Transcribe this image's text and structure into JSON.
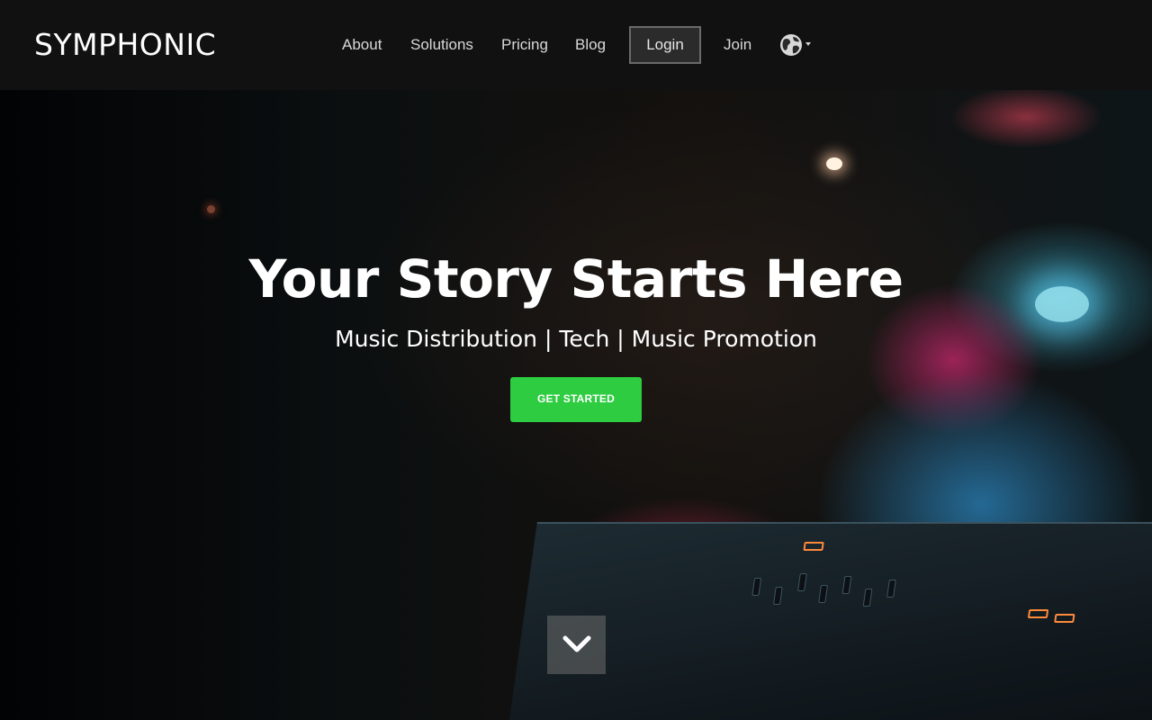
{
  "brand": {
    "name": "SYMPHONIC"
  },
  "nav": {
    "items": [
      {
        "label": "About"
      },
      {
        "label": "Solutions"
      },
      {
        "label": "Pricing"
      },
      {
        "label": "Blog"
      },
      {
        "label": "Login"
      },
      {
        "label": "Join"
      }
    ],
    "language_icon": "globe-icon"
  },
  "hero": {
    "title": "Your Story Starts Here",
    "subtitle": "Music Distribution | Tech | Music Promotion",
    "cta_label": "GET STARTED",
    "scroll_icon": "chevron-down-icon"
  },
  "colors": {
    "header_bg": "#111111",
    "cta_bg": "#2ecc40",
    "text": "#ffffff"
  }
}
